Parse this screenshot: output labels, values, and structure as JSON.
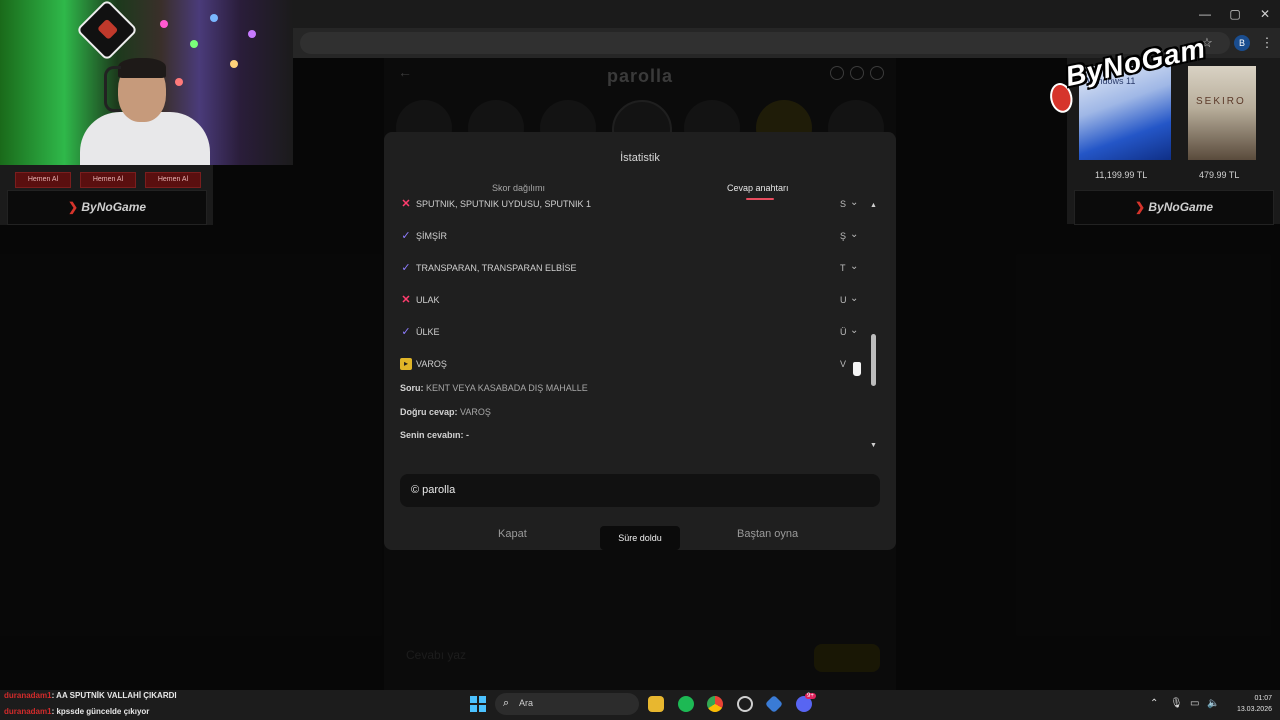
{
  "browser": {
    "window_controls": [
      "—",
      "▢",
      "✕"
    ],
    "profile_initial": "B"
  },
  "game": {
    "title": "parolla",
    "bottom_input_placeholder": "Cevabı yaz"
  },
  "modal": {
    "title": "İstatistik",
    "tabs": [
      {
        "label": "Skor dağılımı",
        "active": false
      },
      {
        "label": "Cevap anahtarı",
        "active": true
      }
    ],
    "answers": [
      {
        "status": "wrong",
        "answer": "SPUTNIK, SPUTNIK UYDUSU, SPUTNIK 1",
        "letter": "S"
      },
      {
        "status": "correct",
        "answer": "ŞİMŞİR",
        "letter": "Ş"
      },
      {
        "status": "correct",
        "answer": "TRANSPARAN, TRANSPARAN ELBİSE",
        "letter": "T"
      },
      {
        "status": "wrong",
        "answer": "ULAK",
        "letter": "U"
      },
      {
        "status": "correct",
        "answer": "ÜLKE",
        "letter": "Ü"
      },
      {
        "status": "passed",
        "answer": "VAROŞ",
        "letter": "V"
      }
    ],
    "detail": {
      "question_label": "Soru:",
      "question": "KENT VEYA KASABADA DIŞ MAHALLE",
      "correct_label": "Doğru cevap:",
      "correct": "VAROŞ",
      "yours_label": "Senin cevabın:",
      "yours": "-"
    },
    "brand": "© parolla",
    "buttons": {
      "close": "Kapat",
      "status": "Süre doldu",
      "restart": "Baştan oyna"
    }
  },
  "ads": {
    "buy_buttons": [
      "Hemen Al",
      "Hemen Al",
      "Hemen Al"
    ],
    "banner_left": "ByNoGame",
    "banner_right": "ByNoGame",
    "products": [
      {
        "name": "Windows 11",
        "price": "11,199.99 TL"
      },
      {
        "name": "SEKIRO",
        "price": "479.99 TL"
      }
    ],
    "stream_logo": "ByNoGam"
  },
  "chat": [
    {
      "user": "duranadam1",
      "message": ": AA SPUTNİK VALLAHİ ÇIKARDI"
    },
    {
      "user": "duranadam1",
      "message": ": kpssde güncelde çıkıyor"
    }
  ],
  "taskbar": {
    "search_placeholder": "Ara",
    "time": "01:07",
    "date": "13.03.2026",
    "discord_badge": "9+"
  },
  "colors": {
    "wrong": "#ff3d6e",
    "correct": "#8e7dff",
    "passed": "#e0b528",
    "tab_underline": "#e74c5e"
  }
}
